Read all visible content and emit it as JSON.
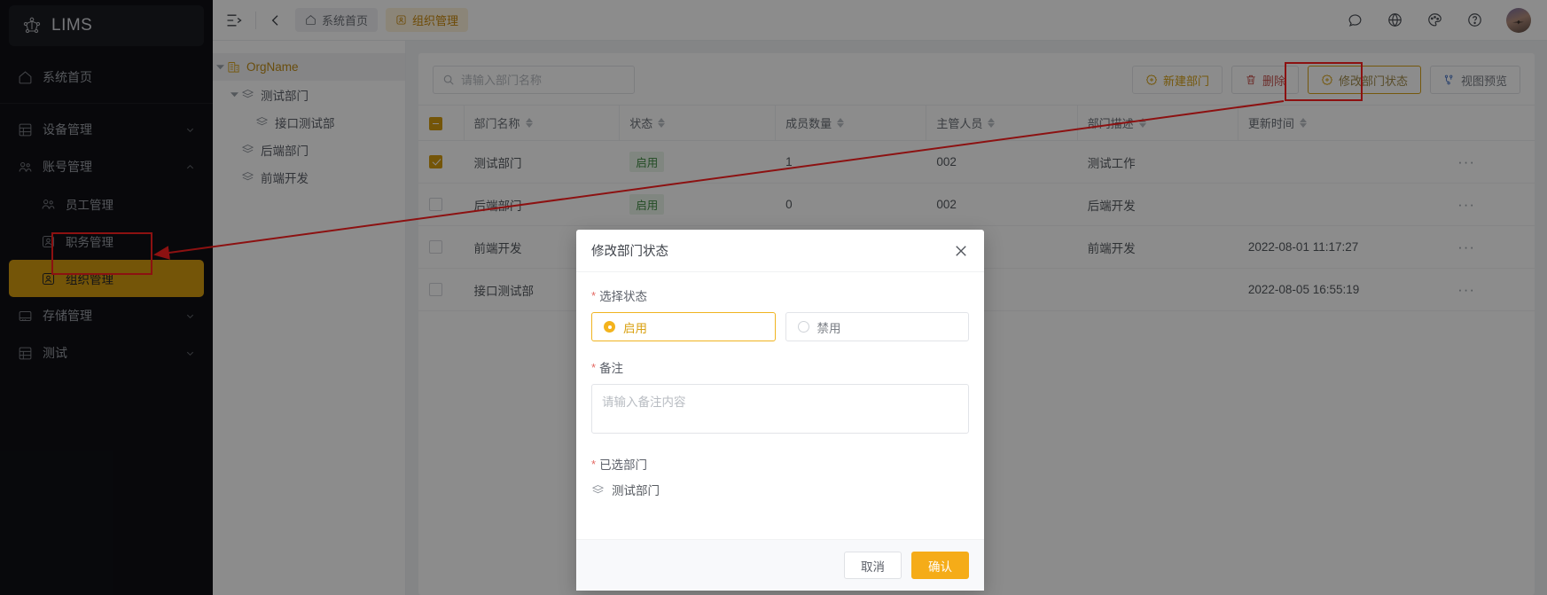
{
  "app": {
    "brand": "LIMS"
  },
  "sidebar": {
    "home": {
      "label": "系统首页",
      "icon": "home-icon"
    },
    "groups": [
      {
        "label": "设备管理",
        "icon": "grid-icon",
        "expanded": false,
        "chevron": "chevron-down-icon"
      },
      {
        "label": "账号管理",
        "icon": "users-icon",
        "expanded": true,
        "chevron": "chevron-up-icon",
        "children": [
          {
            "label": "员工管理",
            "icon": "users-icon",
            "active": false
          },
          {
            "label": "职务管理",
            "icon": "badge-icon",
            "active": false
          },
          {
            "label": "组织管理",
            "icon": "badge-icon",
            "active": true
          }
        ]
      },
      {
        "label": "存储管理",
        "icon": "storage-icon",
        "expanded": false,
        "chevron": "chevron-down-icon"
      },
      {
        "label": "测试",
        "icon": "grid-icon",
        "expanded": false,
        "chevron": "chevron-down-icon"
      }
    ]
  },
  "topbar": {
    "collapse_icon": "sidebar-collapse-icon",
    "back_icon": "chevron-left-icon",
    "breadcrumbs": [
      {
        "label": "系统首页",
        "icon": "home-icon",
        "style": "plain"
      },
      {
        "label": "组织管理",
        "icon": "badge-icon",
        "style": "amber"
      }
    ],
    "right_icons": [
      "message-icon",
      "globe-icon",
      "palette-icon",
      "help-icon",
      "avatar"
    ]
  },
  "tree": {
    "nodes": [
      {
        "label": "OrgName",
        "level": 0,
        "icon": "building-icon",
        "expandable": true,
        "expanded": true,
        "selected": true
      },
      {
        "label": "测试部门",
        "level": 1,
        "icon": "layers-icon",
        "expandable": true,
        "expanded": true,
        "selected": false
      },
      {
        "label": "接口测试部",
        "level": 2,
        "icon": "layers-icon",
        "expandable": false,
        "selected": false
      },
      {
        "label": "后端部门",
        "level": 1,
        "icon": "layers-icon",
        "expandable": false,
        "selected": false
      },
      {
        "label": "前端开发",
        "level": 1,
        "icon": "layers-icon",
        "expandable": false,
        "selected": false
      }
    ]
  },
  "toolbar": {
    "search_placeholder": "请输入部门名称",
    "search_value": "",
    "search_icon": "search-icon",
    "buttons": [
      {
        "label": "新建部门",
        "icon": "plus-circle-icon",
        "style": "amber"
      },
      {
        "label": "删除",
        "icon": "trash-icon",
        "style": "danger"
      },
      {
        "label": "修改部门状态",
        "icon": "plus-circle-icon",
        "style": "outline-amber",
        "highlighted": true
      },
      {
        "label": "视图预览",
        "icon": "flow-icon",
        "style": "blue"
      }
    ]
  },
  "table": {
    "header_checkbox_state": "indeterminate",
    "columns": [
      {
        "key": "name",
        "label": "部门名称",
        "sortable": true
      },
      {
        "key": "state",
        "label": "状态",
        "sortable": true
      },
      {
        "key": "count",
        "label": "成员数量",
        "sortable": true
      },
      {
        "key": "head",
        "label": "主管人员",
        "sortable": true
      },
      {
        "key": "desc",
        "label": "部门描述",
        "sortable": true
      },
      {
        "key": "time",
        "label": "更新时间",
        "sortable": true
      }
    ],
    "rows": [
      {
        "checked": true,
        "name": "测试部门",
        "state": "启用",
        "count": "1",
        "head": "002",
        "desc": "测试工作",
        "time": "",
        "ops": "···"
      },
      {
        "checked": false,
        "name": "后端部门",
        "state": "启用",
        "count": "0",
        "head": "002",
        "desc": "后端开发",
        "time": "",
        "ops": "···"
      },
      {
        "checked": false,
        "name": "前端开发",
        "state": "",
        "count": "",
        "head": "",
        "desc": "前端开发",
        "time": "2022-08-01 11:17:27",
        "ops": "···"
      },
      {
        "checked": false,
        "name": "接口测试部",
        "state": "",
        "count": "",
        "head": "",
        "desc": "",
        "time": "2022-08-05 16:55:19",
        "ops": "···"
      }
    ]
  },
  "modal": {
    "title": "修改部门状态",
    "close_icon": "close-icon",
    "state_label": "选择状态",
    "options": [
      {
        "label": "启用",
        "selected": true
      },
      {
        "label": "禁用",
        "selected": false
      }
    ],
    "remark_label": "备注",
    "remark_placeholder": "请输入备注内容",
    "remark_value": "",
    "selected_label": "已选部门",
    "selected_dept": "测试部门",
    "selected_dept_icon": "layers-icon",
    "cancel_label": "取消",
    "confirm_label": "确认"
  },
  "annotations": {
    "color": "#ff1f1f",
    "boxes": [
      "sidebar-item-组织管理",
      "修改部门状态-button"
    ],
    "arrow": "from 修改部门状态 button to 组织管理 sidebar item"
  },
  "colors": {
    "accent_amber": "#d49b10",
    "primary_button": "#f5ac18",
    "sidebar_bg": "#0f1015",
    "enabled_tag_text": "#3f8a42",
    "annotation_red": "#ff1f1f"
  }
}
